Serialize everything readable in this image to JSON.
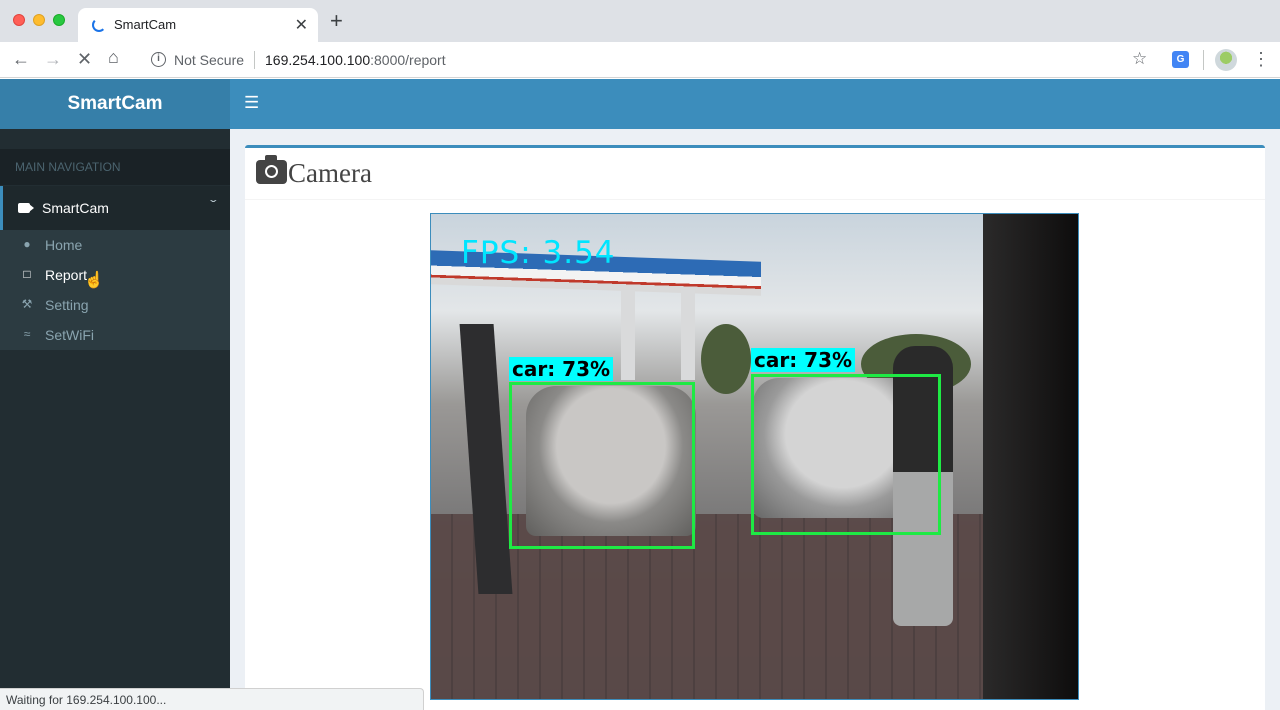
{
  "browser": {
    "tab_title": "SmartCam",
    "new_tab_symbol": "+",
    "tab_close_symbol": "✕",
    "security_label": "Not Secure",
    "url_host": "169.254.100.100",
    "url_path": ":8000/report",
    "status_text": "Waiting for 169.254.100.100..."
  },
  "app": {
    "logo": "SmartCam",
    "sidebar": {
      "header": "MAIN NAVIGATION",
      "tree_label": "SmartCam",
      "items": [
        {
          "label": "Home",
          "icon": "user-icon"
        },
        {
          "label": "Report",
          "icon": "bookmark-icon"
        },
        {
          "label": "Setting",
          "icon": "wrench-icon"
        },
        {
          "label": "SetWiFi",
          "icon": "wifi-icon"
        }
      ]
    },
    "box_title": "Camera"
  },
  "feed": {
    "fps_text": "FPS: 3.54",
    "detections": [
      {
        "label": "car: 73%"
      },
      {
        "label": "car: 73%"
      }
    ]
  },
  "colors": {
    "navbar": "#3c8dbc",
    "logo_bg": "#367fa9",
    "sidebar_bg": "#222d32",
    "detection_box": "#1eea44",
    "detection_label_bg": "#00ffff"
  }
}
